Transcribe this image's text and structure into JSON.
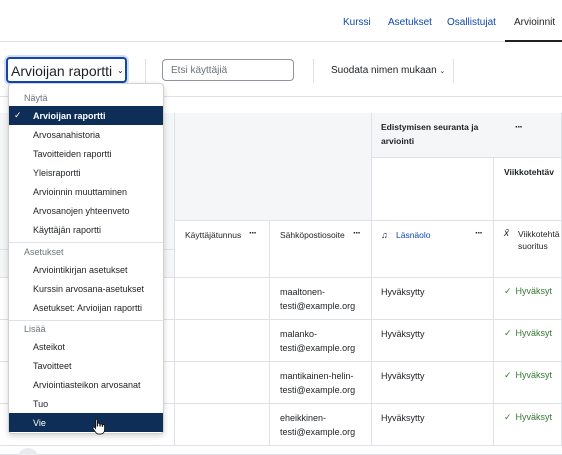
{
  "nav": {
    "tabs": [
      {
        "label": "Kurssi",
        "active": false
      },
      {
        "label": "Asetukset",
        "active": false
      },
      {
        "label": "Osallistujat",
        "active": false
      },
      {
        "label": "Arvioinnit",
        "active": true
      }
    ]
  },
  "toolbar": {
    "report_select_value": "Arvioijan raportti",
    "search_placeholder": "Etsi käyttäjiä",
    "name_filter_label": "Suodata nimen mukaan"
  },
  "menu": {
    "groups": [
      {
        "label": "Näytä",
        "items": [
          {
            "label": "Arvioijan raportti",
            "selected": true
          },
          {
            "label": "Arvosanahistoria"
          },
          {
            "label": "Tavoitteiden raportti"
          },
          {
            "label": "Yleisraportti"
          },
          {
            "label": "Arvioinnin muuttaminen"
          },
          {
            "label": "Arvosanojen yhteenveto"
          },
          {
            "label": "Käyttäjän raportti"
          }
        ]
      },
      {
        "label": "Asetukset",
        "items": [
          {
            "label": "Arviointikirjan asetukset"
          },
          {
            "label": "Kurssin arvosana-asetukset"
          },
          {
            "label": "Asetukset: Arvioijan raportti"
          }
        ]
      },
      {
        "label": "Lisää",
        "items": [
          {
            "label": "Asteikot"
          },
          {
            "label": "Tavoitteet"
          },
          {
            "label": "Arviointiasteikon arvosanat"
          },
          {
            "label": "Tuo"
          },
          {
            "label": "Vie",
            "hovered": true
          }
        ]
      }
    ]
  },
  "table": {
    "category_header": "Edistymisen seuranta ja arviointi",
    "subcategory_header": "Viikkotehtäv",
    "columns": {
      "username": "Käyttäjätunnus",
      "email": "Sähköpostiosoite",
      "attendance": "Läsnäolo",
      "assignment": "Viikkotehtä suoritus"
    },
    "rows": [
      {
        "email": "maaltonen-testi@example.org",
        "email_line1": "maaltonen-",
        "email_line2": "testi@example.org",
        "attendance": "Hyväksytty",
        "grade": "Hyväksyt"
      },
      {
        "email": "malanko-testi@example.org",
        "email_line1": "malanko-",
        "email_line2": "testi@example.org",
        "attendance": "Hyväksytty",
        "grade": "Hyväksyt"
      },
      {
        "email": "mantikainen-helin-testi@example.org",
        "email_line1": "mantikainen-helin-",
        "email_line2": "testi@example.org",
        "attendance": "Hyväksytty",
        "grade": "Hyväksyt"
      },
      {
        "email": "eheikkinen-testi@example.org",
        "email_line1": "eheikkinen-",
        "email_line2": "testi@example.org",
        "attendance": "Hyväksytty",
        "grade": "Hyväksyt"
      }
    ]
  },
  "colors": {
    "accent": "#0f47ad",
    "menu_selected_bg": "#0f2e57",
    "success": "#357a32"
  }
}
